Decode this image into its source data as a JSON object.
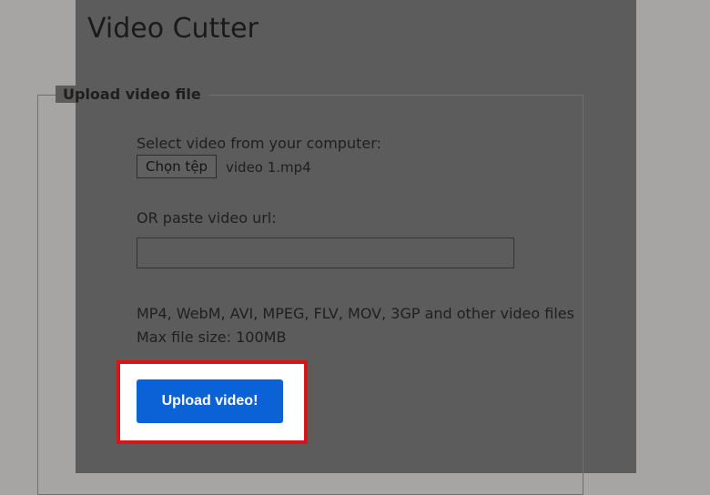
{
  "header": {
    "title": "Video Cutter"
  },
  "upload_form": {
    "legend": "Upload video file",
    "select_label": "Select video from your computer:",
    "choose_file_label": "Chọn tệp",
    "selected_file": "video 1.mp4",
    "url_label": "OR paste video url:",
    "url_value": "",
    "formats_text": "MP4, WebM, AVI, MPEG, FLV, MOV, 3GP and other video files",
    "max_size_text": "Max file size: 100MB",
    "upload_label": "Upload video!"
  },
  "colors": {
    "overlay_page": "#5c5c5c",
    "outer_background": "#a7a5a4",
    "primary_button": "#0b62d6",
    "highlight_border": "#d9151c"
  }
}
